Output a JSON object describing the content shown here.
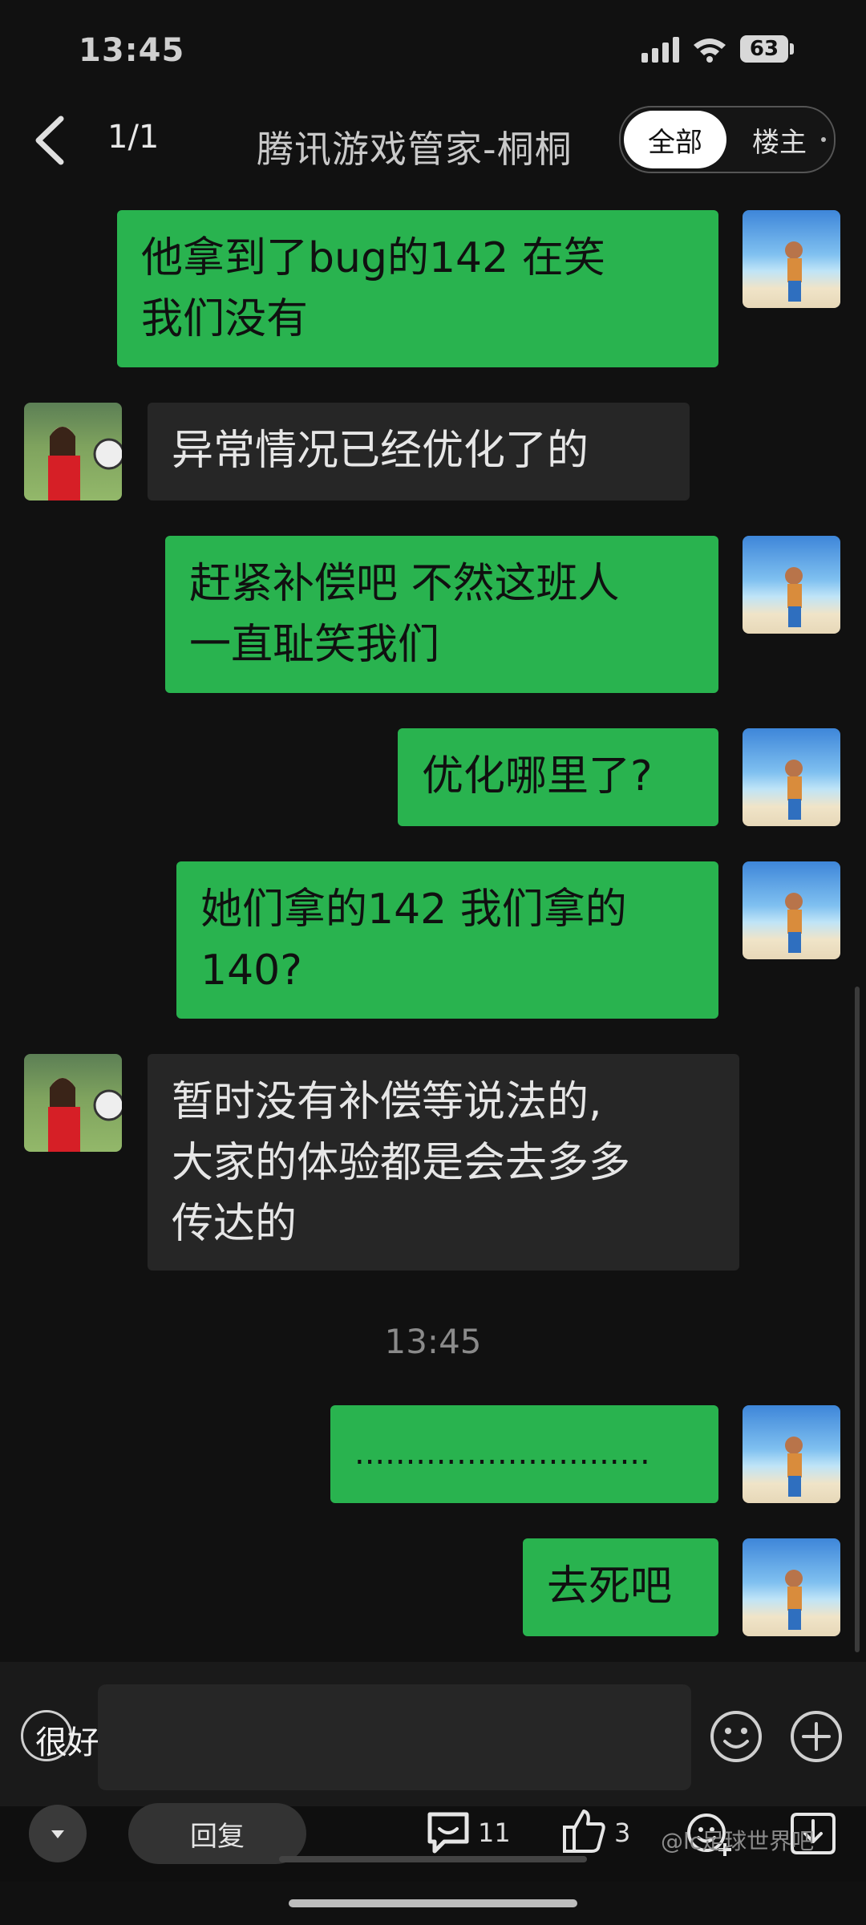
{
  "status_bar": {
    "time": "13:45",
    "battery": "63",
    "icons": [
      "signal-icon",
      "wifi-icon",
      "battery-icon"
    ]
  },
  "header": {
    "page_indicator": "1/1",
    "title": "腾讯游戏管家-桐桐",
    "tabs": [
      {
        "label": "全部",
        "selected": true
      },
      {
        "label": "楼主",
        "selected": false
      }
    ]
  },
  "messages": [
    {
      "from": "me",
      "lines": [
        "他拿到了bug的142 在笑",
        "我们没有"
      ]
    },
    {
      "from": "other",
      "lines": [
        "异常情况已经优化了的"
      ]
    },
    {
      "from": "me",
      "lines": [
        "赶紧补偿吧 不然这班人",
        "一直耻笑我们"
      ]
    },
    {
      "from": "me",
      "lines": [
        "优化哪里了?"
      ]
    },
    {
      "from": "me",
      "lines": [
        "她们拿的142 我们拿的",
        "140?"
      ]
    },
    {
      "from": "other",
      "lines": [
        "暂时没有补偿等说法的,",
        "大家的体验都是会去多多",
        "传达的"
      ]
    },
    {
      "from": "me",
      "lines": [
        "............................."
      ]
    },
    {
      "from": "me",
      "lines": [
        "去死吧"
      ]
    }
  ],
  "time_divider": "13:45",
  "input": {
    "hint": "很好",
    "value": ""
  },
  "bottom_bar": {
    "reply_label": "回复",
    "comment_count": "11",
    "like_count": "3",
    "watermark": "@lc足球世界吧"
  },
  "colors": {
    "background": "#111111",
    "sent_bubble": "#29b34f",
    "received_bubble": "#262626"
  }
}
